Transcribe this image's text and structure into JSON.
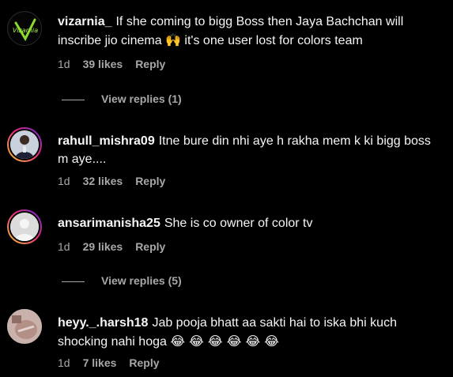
{
  "comments": [
    {
      "username": "vizarnia_",
      "text": "If she coming to bigg Boss then Jaya Bachchan will inscribe jio cinema",
      "emoji": "🙌",
      "text_tail": " it's one user lost for colors team",
      "time": "1d",
      "likes": "39 likes",
      "reply": "Reply",
      "view_replies": "View replies (1)"
    },
    {
      "username": "rahull_mishra09",
      "text": "Itne bure din nhi aye h rakha mem k ki bigg boss m aye....",
      "time": "1d",
      "likes": "32 likes",
      "reply": "Reply"
    },
    {
      "username": "ansarimanisha25",
      "text": "She is co owner of color tv",
      "time": "1d",
      "likes": "29 likes",
      "reply": "Reply",
      "view_replies": "View replies (5)"
    },
    {
      "username": "heyy._.harsh18",
      "text": "Jab pooja bhatt aa sakti hai to iska bhi kuch shocking nahi hoga",
      "emoji": "😂 😂 😂 😂 😂 😂",
      "time": "1d",
      "likes": "7 likes",
      "reply": "Reply"
    }
  ],
  "colors": {
    "background": "#000000",
    "text": "#f5f5f5",
    "secondary_text": "#a8a8a8",
    "story_ring": [
      "#f9ce34",
      "#ee2a7b",
      "#6228d7"
    ]
  }
}
